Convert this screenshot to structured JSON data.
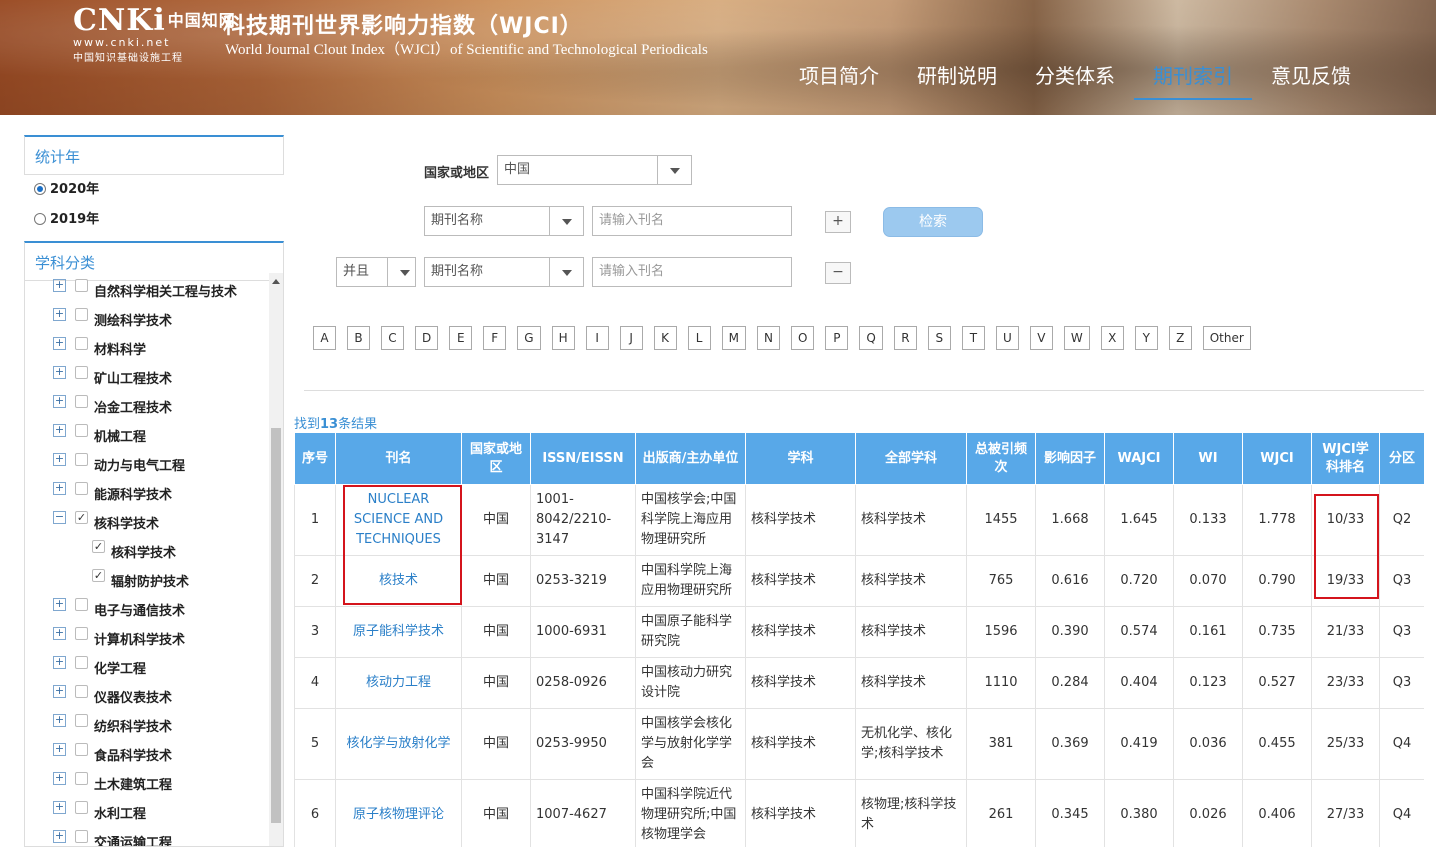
{
  "header": {
    "logo_main": "CNKi",
    "logo_cn": "中国知网",
    "logo_url": "www.cnki.net",
    "logo_sub": "中国知识基础设施工程",
    "title": "科技期刊世界影响力指数（WJCI）",
    "subtitle": "World Journal Clout Index（WJCI）of Scientific and Technological Periodicals",
    "nav": [
      "项目简介",
      "研制说明",
      "分类体系",
      "期刊索引",
      "意见反馈"
    ],
    "active_nav": "期刊索引"
  },
  "sidebar": {
    "year_title": "统计年",
    "years": [
      {
        "label": "2020年",
        "selected": true
      },
      {
        "label": "2019年",
        "selected": false
      }
    ],
    "subject_title": "学科分类",
    "tree": [
      {
        "label": "自然科学相关工程与技术",
        "expand": "+",
        "checked": false,
        "child": false
      },
      {
        "label": "测绘科学技术",
        "expand": "+",
        "checked": false,
        "child": false
      },
      {
        "label": "材料科学",
        "expand": "+",
        "checked": false,
        "child": false
      },
      {
        "label": "矿山工程技术",
        "expand": "+",
        "checked": false,
        "child": false
      },
      {
        "label": "冶金工程技术",
        "expand": "+",
        "checked": false,
        "child": false
      },
      {
        "label": "机械工程",
        "expand": "+",
        "checked": false,
        "child": false
      },
      {
        "label": "动力与电气工程",
        "expand": "+",
        "checked": false,
        "child": false
      },
      {
        "label": "能源科学技术",
        "expand": "+",
        "checked": false,
        "child": false
      },
      {
        "label": "核科学技术",
        "expand": "−",
        "checked": true,
        "child": false
      },
      {
        "label": "核科学技术",
        "expand": "",
        "checked": true,
        "child": true
      },
      {
        "label": "辐射防护技术",
        "expand": "",
        "checked": true,
        "child": true
      },
      {
        "label": "电子与通信技术",
        "expand": "+",
        "checked": false,
        "child": false
      },
      {
        "label": "计算机科学技术",
        "expand": "+",
        "checked": false,
        "child": false
      },
      {
        "label": "化学工程",
        "expand": "+",
        "checked": false,
        "child": false
      },
      {
        "label": "仪器仪表技术",
        "expand": "+",
        "checked": false,
        "child": false
      },
      {
        "label": "纺织科学技术",
        "expand": "+",
        "checked": false,
        "child": false
      },
      {
        "label": "食品科学技术",
        "expand": "+",
        "checked": false,
        "child": false
      },
      {
        "label": "土木建筑工程",
        "expand": "+",
        "checked": false,
        "child": false
      },
      {
        "label": "水利工程",
        "expand": "+",
        "checked": false,
        "child": false
      },
      {
        "label": "交通运输工程",
        "expand": "+",
        "checked": false,
        "child": false
      }
    ]
  },
  "search": {
    "country_label": "国家或地区",
    "country_value": "中国",
    "field1_value": "期刊名称",
    "input1_placeholder": "请输入刊名",
    "add_label": "+",
    "search_label": "检索",
    "logic_value": "并且",
    "field2_value": "期刊名称",
    "input2_placeholder": "请输入刊名",
    "remove_label": "−",
    "letters": [
      "A",
      "B",
      "C",
      "D",
      "E",
      "F",
      "G",
      "H",
      "I",
      "J",
      "K",
      "L",
      "M",
      "N",
      "O",
      "P",
      "Q",
      "R",
      "S",
      "T",
      "U",
      "V",
      "W",
      "X",
      "Y",
      "Z",
      "Other"
    ]
  },
  "results": {
    "prefix": "找到",
    "count": "13",
    "suffix": "条结果",
    "headers": [
      "序号",
      "刊名",
      "国家或地区",
      "ISSN/EISSN",
      "出版商/主办单位",
      "学科",
      "全部学科",
      "总被引频次",
      "影响因子",
      "WAJCI",
      "WI",
      "WJCI",
      "WJCI学科排名",
      "分区"
    ],
    "rows": [
      [
        "1",
        "NUCLEAR SCIENCE AND TECHNIQUES",
        "中国",
        "1001-8042/2210-3147",
        "中国核学会;中国科学院上海应用物理研究所",
        "核科学技术",
        "核科学技术",
        "1455",
        "1.668",
        "1.645",
        "0.133",
        "1.778",
        "10/33",
        "Q2"
      ],
      [
        "2",
        "核技术",
        "中国",
        "0253-3219",
        "中国科学院上海应用物理研究所",
        "核科学技术",
        "核科学技术",
        "765",
        "0.616",
        "0.720",
        "0.070",
        "0.790",
        "19/33",
        "Q3"
      ],
      [
        "3",
        "原子能科学技术",
        "中国",
        "1000-6931",
        "中国原子能科学研究院",
        "核科学技术",
        "核科学技术",
        "1596",
        "0.390",
        "0.574",
        "0.161",
        "0.735",
        "21/33",
        "Q3"
      ],
      [
        "4",
        "核动力工程",
        "中国",
        "0258-0926",
        "中国核动力研究设计院",
        "核科学技术",
        "核科学技术",
        "1110",
        "0.284",
        "0.404",
        "0.123",
        "0.527",
        "23/33",
        "Q3"
      ],
      [
        "5",
        "核化学与放射化学",
        "中国",
        "0253-9950",
        "中国核学会核化学与放射化学学会",
        "核科学技术",
        "无机化学、核化学;核科学技术",
        "381",
        "0.369",
        "0.419",
        "0.036",
        "0.455",
        "25/33",
        "Q4"
      ],
      [
        "6",
        "原子核物理评论",
        "中国",
        "1007-4627",
        "中国科学院近代物理研究所;中国核物理学会",
        "核科学技术",
        "核物理;核科学技术",
        "261",
        "0.345",
        "0.380",
        "0.026",
        "0.406",
        "27/33",
        "Q4"
      ]
    ]
  },
  "colors": {
    "accent": "#3a8fd4",
    "table_header": "#58a8e8",
    "highlight": "#d4141c"
  }
}
